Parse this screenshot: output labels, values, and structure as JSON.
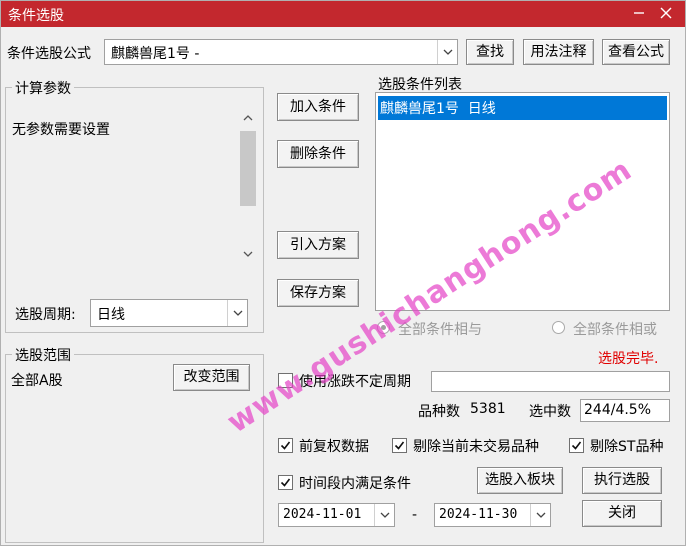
{
  "window": {
    "title": "条件选股",
    "minimize_icon": "minimize-icon",
    "close_icon": "close-icon"
  },
  "formula": {
    "label": "条件选股公式",
    "value": "麒麟兽尾1号  -",
    "buttons": {
      "find": "查找",
      "usage": "用法注释",
      "view": "查看公式"
    }
  },
  "params": {
    "title": "计算参数",
    "text": "无参数需要设置",
    "period_label": "选股周期:",
    "period_value": "日线"
  },
  "actions": {
    "add": "加入条件",
    "delete": "删除条件",
    "import": "引入方案",
    "save": "保存方案"
  },
  "conditions": {
    "title": "选股条件列表",
    "items": [
      "麒麟兽尾1号  日线"
    ],
    "radio_and": "全部条件相与",
    "radio_or": "全部条件相或",
    "status": "选股完毕."
  },
  "range": {
    "title": "选股范围",
    "value": "全部A股",
    "change_button": "改变范围"
  },
  "options": {
    "use_variable_period": "使用涨跌不定周期",
    "stock_count_label": "品种数",
    "stock_count": "5381",
    "selected_label": "选中数",
    "selected_value": "244/4.5%",
    "prior_adjusted": "前复权数据",
    "exclude_untraded": "剔除当前未交易品种",
    "exclude_st": "剔除ST品种",
    "time_range": "时间段内满足条件",
    "date_from": "2024-11-01",
    "date_sep": "-",
    "date_to": "2024-11-30"
  },
  "buttons": {
    "to_block": "选股入板块",
    "execute": "执行选股",
    "close": "关闭"
  },
  "watermark": "www.gushichanghong.com",
  "colors": {
    "title_bar": "#c3282e",
    "selection": "#0078d7",
    "status_red": "#e00000",
    "watermark": "#e446c8"
  }
}
